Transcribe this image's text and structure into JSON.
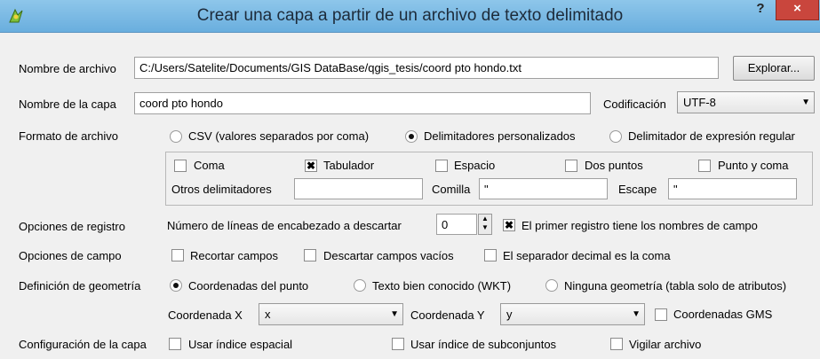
{
  "window": {
    "title": "Crear una capa a partir de un archivo de texto delimitado",
    "help": "?",
    "close": "×"
  },
  "file": {
    "label": "Nombre de archivo",
    "value": "C:/Users/Satelite/Documents/GIS DataBase/qgis_tesis/coord pto hondo.txt",
    "browse": "Explorar..."
  },
  "layer": {
    "label": "Nombre de la capa",
    "value": "coord pto hondo",
    "encoding_label": "Codificación",
    "encoding_value": "UTF-8"
  },
  "format": {
    "label": "Formato de archivo",
    "options": [
      "CSV (valores separados por coma)",
      "Delimitadores personalizados",
      "Delimitador de expresión regular"
    ],
    "selected_index": 1
  },
  "delimiters": {
    "checks": [
      {
        "label": "Coma",
        "checked": false
      },
      {
        "label": "Tabulador",
        "checked": true
      },
      {
        "label": "Espacio",
        "checked": false
      },
      {
        "label": "Dos puntos",
        "checked": false
      },
      {
        "label": "Punto y coma",
        "checked": false
      }
    ],
    "other_label": "Otros delimitadores",
    "other_value": "",
    "quote_label": "Comilla",
    "quote_value": "\"",
    "escape_label": "Escape",
    "escape_value": "\""
  },
  "records": {
    "label": "Opciones de registro",
    "skip_label": "Número de líneas de encabezado a descartar",
    "skip_value": "0",
    "header_label": "El primer registro tiene los nombres de campo",
    "header_checked": true
  },
  "fields": {
    "label": "Opciones de campo",
    "trim": "Recortar campos",
    "discard": "Descartar campos vacíos",
    "decimal": "El separador decimal es la coma"
  },
  "geometry": {
    "label": "Definición de geometría",
    "options": [
      "Coordenadas del punto",
      "Texto bien conocido (WKT)",
      "Ninguna geometría (tabla solo de atributos)"
    ],
    "selected_index": 0,
    "x_label": "Coordenada X",
    "x_value": "x",
    "y_label": "Coordenada Y",
    "y_value": "y",
    "dms_label": "Coordenadas GMS"
  },
  "layer_settings": {
    "label": "Configuración de la capa",
    "spatial_index": "Usar índice espacial",
    "subset_index": "Usar índice de subconjuntos",
    "watch": "Vigilar archivo"
  },
  "icons": {
    "app": "qgis-logo-icon",
    "dropdown": "▼",
    "spin_up": "▲",
    "spin_down": "▼",
    "check": "✖"
  }
}
